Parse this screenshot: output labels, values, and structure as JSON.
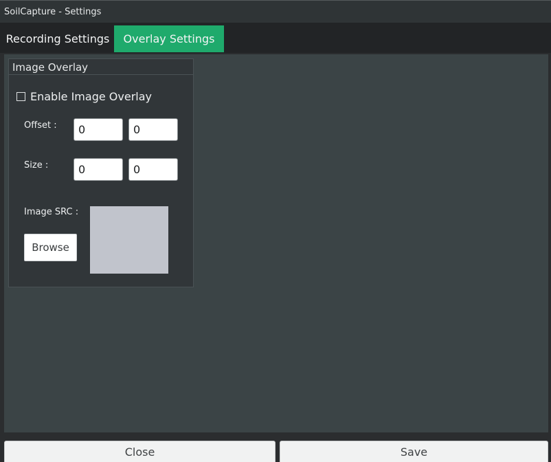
{
  "window": {
    "title": "SoilCapture - Settings"
  },
  "tabs": [
    {
      "label": "Recording Settings",
      "active": false
    },
    {
      "label": "Overlay Settings",
      "active": true
    }
  ],
  "image_overlay": {
    "group_title": "Image Overlay",
    "enable_label": "Enable Image Overlay",
    "enable_checked": false,
    "offset_label": "Offset :",
    "offset_x": "0",
    "offset_y": "0",
    "size_label": "Size :",
    "size_w": "0",
    "size_h": "0",
    "image_src_label": "Image SRC :",
    "browse_label": "Browse"
  },
  "footer": {
    "close_label": "Close",
    "save_label": "Save"
  },
  "colors": {
    "accent": "#1faa6c",
    "panel": "#3b4446",
    "titlebar": "#2f3436"
  },
  "icons": [
    "checkbox-icon"
  ]
}
